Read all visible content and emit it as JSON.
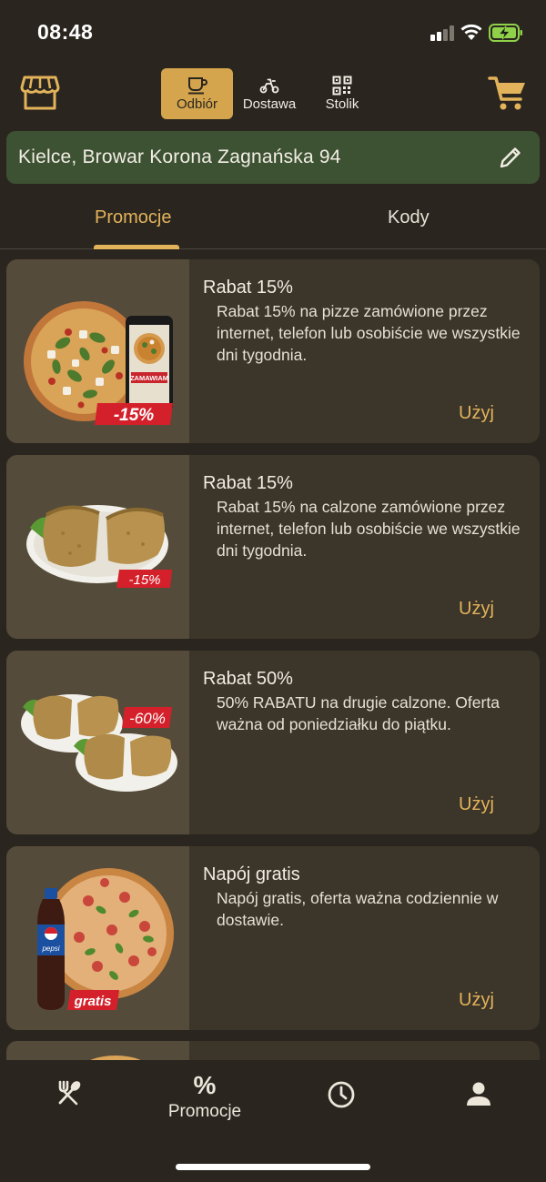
{
  "status_bar": {
    "time": "08:48"
  },
  "header": {
    "modes": [
      {
        "label": "Odbiór",
        "icon": "cup-icon",
        "active": true
      },
      {
        "label": "Dostawa",
        "icon": "scooter-icon",
        "active": false
      },
      {
        "label": "Stolik",
        "icon": "qr-code-icon",
        "active": false
      }
    ]
  },
  "address": {
    "text": "Kielce, Browar Korona Zagnańska 94"
  },
  "subtabs": [
    {
      "label": "Promocje",
      "active": true
    },
    {
      "label": "Kody",
      "active": false
    }
  ],
  "promotions": [
    {
      "title": "Rabat 15%",
      "description": "Rabat 15% na pizze zamówione przez internet, telefon lub osobiście we wszystkie dni tygodnia.",
      "use_label": "Użyj",
      "image_badge": "-15%",
      "phone_label": "ZAMAWIAM"
    },
    {
      "title": "Rabat 15%",
      "description": "Rabat 15% na calzone zamówione przez internet, telefon lub osobiście we wszystkie dni tygodnia.",
      "use_label": "Użyj",
      "image_badge": "-15%"
    },
    {
      "title": "Rabat 50%",
      "description": "50% RABATU na drugie calzone. Oferta ważna od poniedziałku do piątku.",
      "use_label": "Użyj",
      "image_badge": "-60%"
    },
    {
      "title": "Napój gratis",
      "description": "Napój gratis, oferta ważna codziennie w dostawie.",
      "use_label": "Użyj",
      "image_badge": "gratis",
      "bottle_label": "pepsi"
    }
  ],
  "bottom_nav": {
    "items": [
      {
        "icon": "cutlery-icon",
        "label": ""
      },
      {
        "icon": "percent-icon",
        "label": "Promocje",
        "active": true
      },
      {
        "icon": "clock-icon",
        "label": ""
      },
      {
        "icon": "user-icon",
        "label": ""
      }
    ],
    "promo_symbol": "%"
  },
  "colors": {
    "background": "#2a261f",
    "accent": "#e3b35b",
    "active_mode_bg": "#d5a54e",
    "address_bg": "#3d5233",
    "card_bg": "#3c3529",
    "card_image_bg": "#554b3a",
    "badge_red": "#d4202a"
  }
}
